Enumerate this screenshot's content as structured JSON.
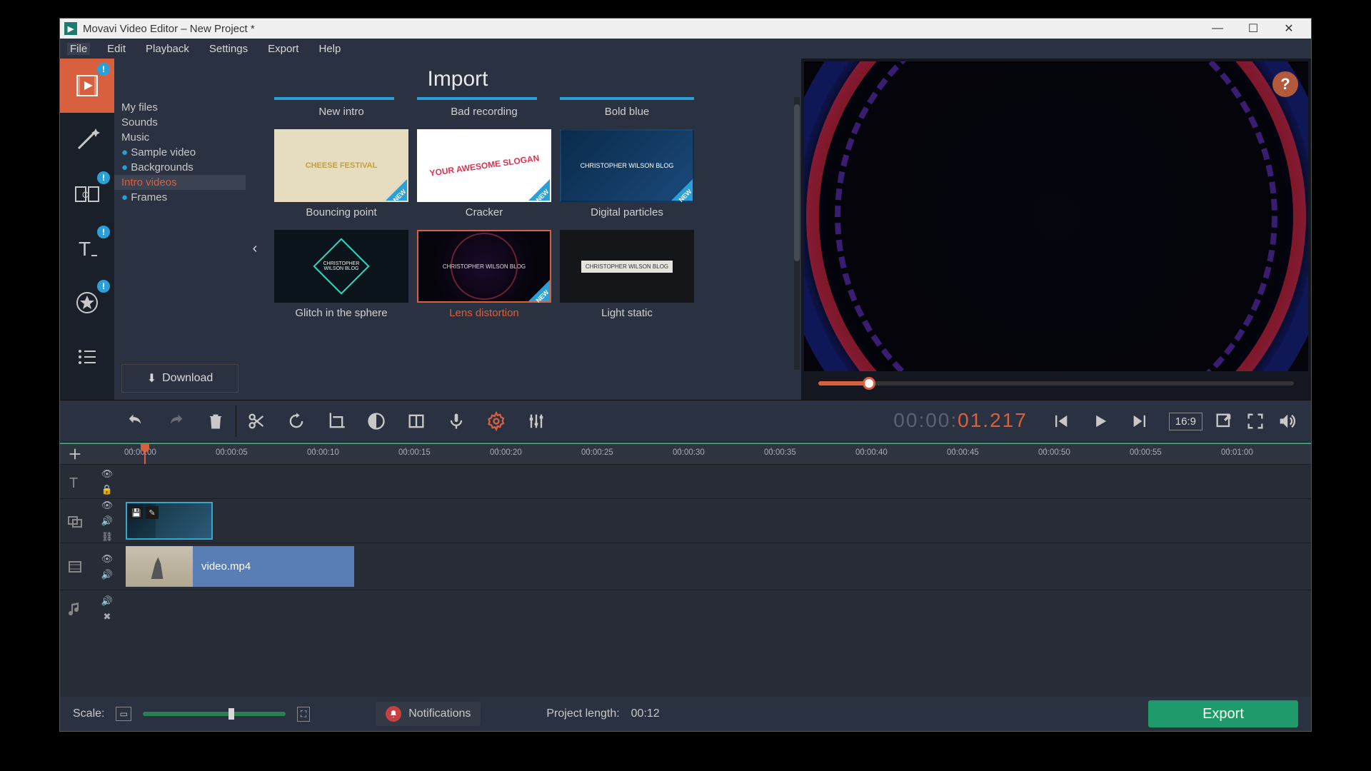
{
  "titlebar": {
    "title": "Movavi Video Editor – New Project *"
  },
  "menubar": [
    "File",
    "Edit",
    "Playback",
    "Settings",
    "Export",
    "Help"
  ],
  "panel": {
    "title": "Import",
    "categories": [
      {
        "label": "My files",
        "bullet": false
      },
      {
        "label": "Sounds",
        "bullet": false
      },
      {
        "label": "Music",
        "bullet": false
      },
      {
        "label": "Sample video",
        "bullet": true
      },
      {
        "label": "Backgrounds",
        "bullet": true
      },
      {
        "label": "Intro videos",
        "bullet": false,
        "selected": true
      },
      {
        "label": "Frames",
        "bullet": true
      }
    ],
    "download": "Download",
    "grid": [
      {
        "label": "New intro",
        "barOnly": true
      },
      {
        "label": "Bad recording",
        "barOnly": true
      },
      {
        "label": "Bold blue",
        "barOnly": true
      },
      {
        "label": "Bouncing point",
        "style": "bouncing",
        "new": true,
        "inner": "CHEESE FESTIVAL"
      },
      {
        "label": "Cracker",
        "style": "cracker",
        "new": true,
        "inner": "YOUR AWESOME SLOGAN"
      },
      {
        "label": "Digital particles",
        "style": "digital",
        "new": true,
        "inner": "CHRISTOPHER WILSON BLOG"
      },
      {
        "label": "Glitch in the sphere",
        "style": "glitch",
        "new": false,
        "inner": "CHRISTOPHER WILSON BLOG"
      },
      {
        "label": "Lens distortion",
        "style": "lens",
        "new": true,
        "selected": true,
        "inner": "CHRISTOPHER WILSON BLOG"
      },
      {
        "label": "Light static",
        "style": "light",
        "new": false,
        "inner": "CHRISTOPHER WILSON BLOG"
      }
    ]
  },
  "preview": {
    "help": "?",
    "timecode_gray": "00:00:",
    "timecode_orange": "01.217",
    "aspect": "16:9"
  },
  "ruler": [
    "00:00:00",
    "00:00:05",
    "00:00:10",
    "00:00:15",
    "00:00:20",
    "00:00:25",
    "00:00:30",
    "00:00:35",
    "00:00:40",
    "00:00:45",
    "00:00:50",
    "00:00:55",
    "00:01:00"
  ],
  "clips": {
    "video_name": "video.mp4"
  },
  "bottom": {
    "scale": "Scale:",
    "notifications": "Notifications",
    "project_length_label": "Project length:",
    "project_length_value": "00:12",
    "export": "Export"
  }
}
